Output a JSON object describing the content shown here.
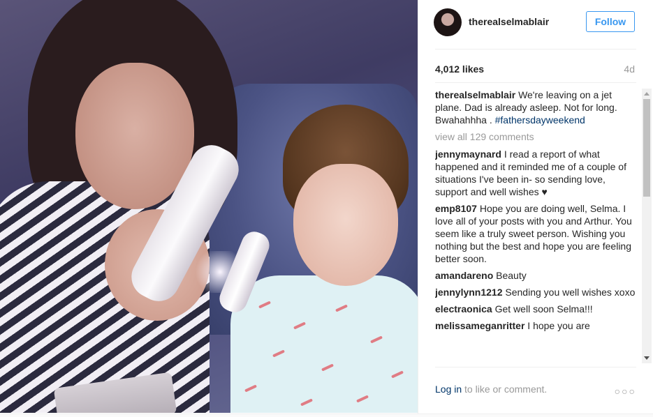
{
  "post": {
    "photo_alt": "",
    "username": "therealselmablair",
    "follow_label": "Follow",
    "likes": "4,012 likes",
    "age": "4d",
    "caption": {
      "user": "therealselmablair",
      "text": "We're leaving on a jet plane. Dad is already asleep. Not for long. Bwahahhha .",
      "hashtag": "#fathersdayweekend"
    },
    "view_all": "view all 129 comments",
    "comments": [
      {
        "user": "jennymaynard",
        "text": "I read a report of what happened and it reminded me of a couple of situations I've been in- so sending love, support and well wishes ♥"
      },
      {
        "user": "emp8107",
        "text": "Hope you are doing well, Selma. I love all of your posts with you and Arthur. You seem like a truly sweet person. Wishing you nothing but the best and hope you are feeling better soon."
      },
      {
        "user": "amandareno",
        "text": "Beauty"
      },
      {
        "user": "jennylynn1212",
        "text": "Sending you well wishes xoxo"
      },
      {
        "user": "electraonica",
        "text": "Get well soon Selma!!!"
      },
      {
        "user": "melissameganritter",
        "text": "I hope you are"
      }
    ],
    "footer": {
      "login_link": "Log in",
      "login_rest": " to like or comment.",
      "more": "○○○"
    }
  }
}
